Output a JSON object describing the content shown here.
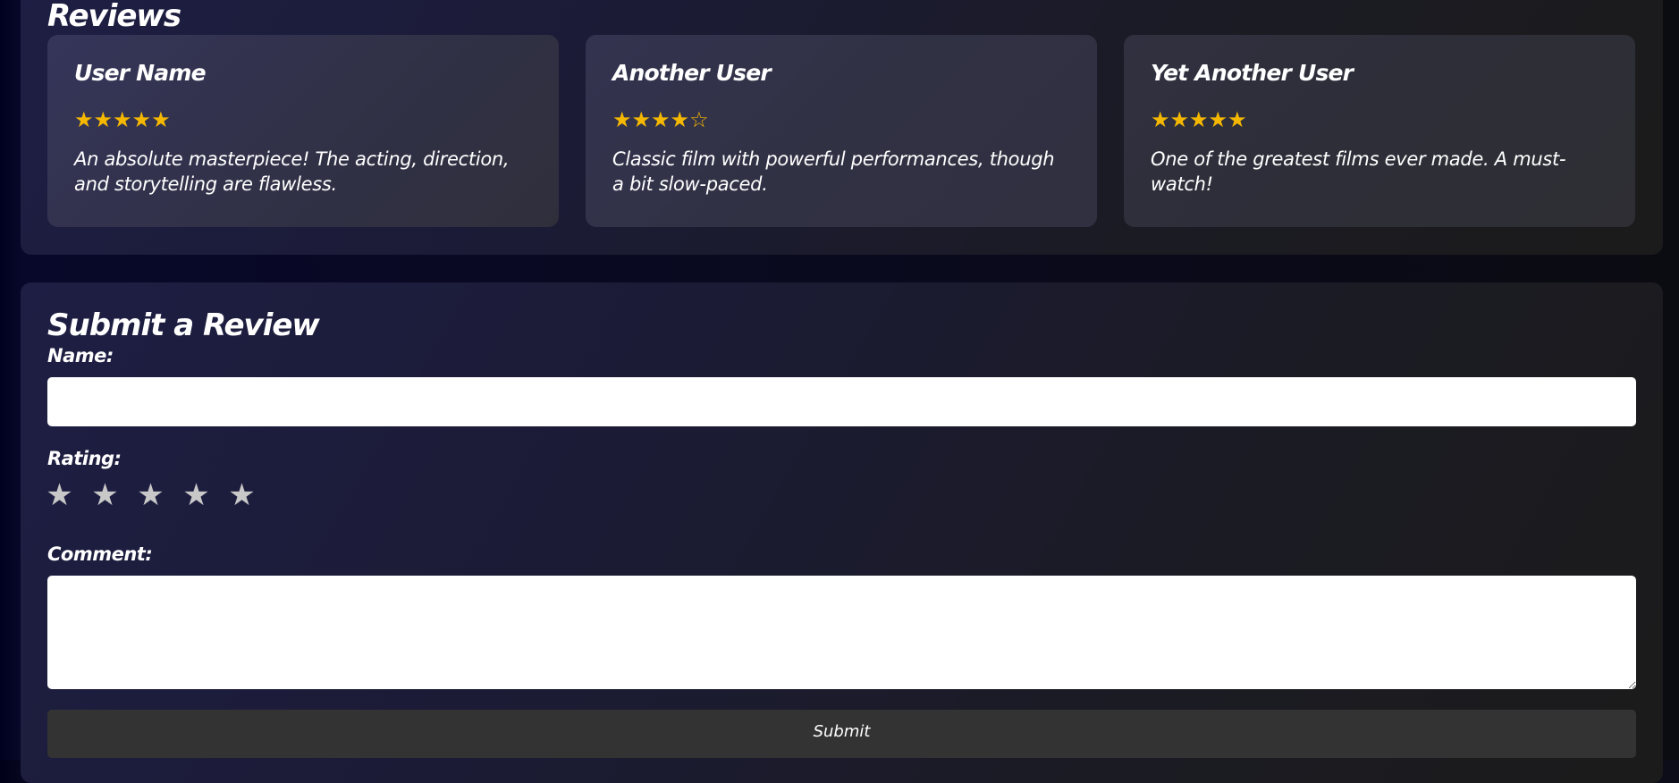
{
  "reviews": {
    "title": "Reviews",
    "items": [
      {
        "name": "User Name",
        "stars": "★★★★★",
        "rating": 5,
        "text": "An absolute masterpiece! The acting, direction, and storytelling are flawless."
      },
      {
        "name": "Another User",
        "stars": "★★★★☆",
        "rating": 4,
        "text": "Classic film with powerful performances, though a bit slow-paced."
      },
      {
        "name": "Yet Another User",
        "stars": "★★★★★",
        "rating": 5,
        "text": "One of the greatest films ever made. A must-watch!"
      }
    ]
  },
  "form": {
    "title": "Submit a Review",
    "name_label": "Name:",
    "name_value": "",
    "rating_label": "Rating:",
    "rating_star": "★",
    "rating_value": 0,
    "comment_label": "Comment:",
    "comment_value": "",
    "submit_label": "Submit"
  },
  "colors": {
    "star_filled": "#f5b800",
    "star_empty": "#c8c8c8",
    "button_bg": "#333333"
  }
}
